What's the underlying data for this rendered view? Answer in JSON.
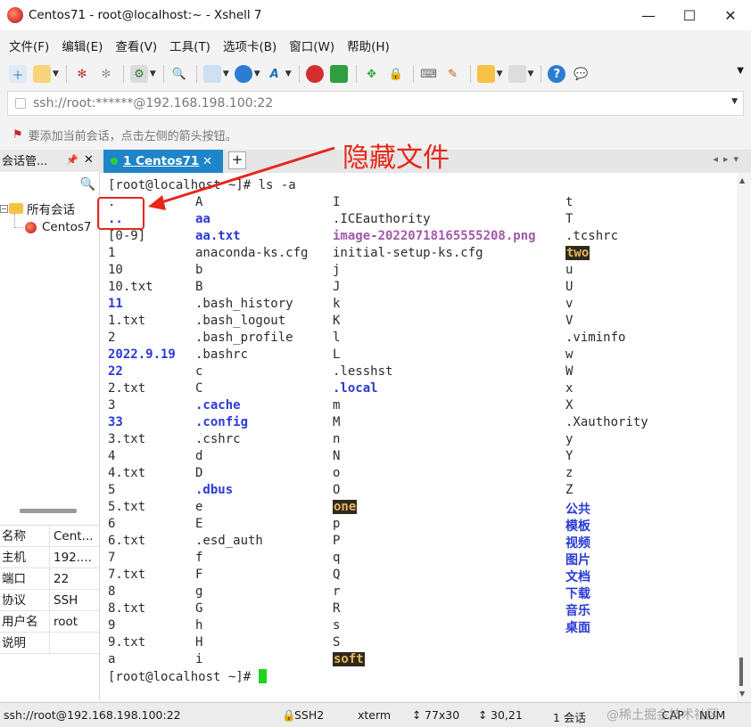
{
  "window": {
    "title": "Centos71 - root@localhost:~ - Xshell 7",
    "minimize": "—",
    "maximize": "☐",
    "close": "✕"
  },
  "menu": [
    "文件(F)",
    "编辑(E)",
    "查看(V)",
    "工具(T)",
    "选项卡(B)",
    "窗口(W)",
    "帮助(H)"
  ],
  "address": {
    "value": "ssh://root:******@192.168.198.100:22"
  },
  "hint": "要添加当前会话，点击左侧的箭头按钮。",
  "sidebar": {
    "header": "会话管...",
    "pin": "📌",
    "close": "✕",
    "tree_root": "所有会话",
    "tree_child": "Centos7",
    "props": [
      {
        "k": "名称",
        "v": "Cent..."
      },
      {
        "k": "主机",
        "v": "192...."
      },
      {
        "k": "端口",
        "v": "22"
      },
      {
        "k": "协议",
        "v": "SSH"
      },
      {
        "k": "用户名",
        "v": "root"
      },
      {
        "k": "说明",
        "v": ""
      }
    ]
  },
  "tab": {
    "label": "1 Centos71",
    "close": "✕",
    "add": "+"
  },
  "terminal": {
    "command_line": "[root@localhost ~]# ls -a",
    "prompt": "[root@localhost ~]# ",
    "col1": [
      {
        "t": ".",
        "c": "plain"
      },
      {
        "t": "..",
        "c": "dir"
      },
      {
        "t": "[0-9]",
        "c": "plain"
      },
      {
        "t": "1",
        "c": "plain"
      },
      {
        "t": "10",
        "c": "plain"
      },
      {
        "t": "10.txt",
        "c": "plain"
      },
      {
        "t": "11",
        "c": "dir"
      },
      {
        "t": "1.txt",
        "c": "plain"
      },
      {
        "t": "2",
        "c": "plain"
      },
      {
        "t": "2022.9.19",
        "c": "dir"
      },
      {
        "t": "22",
        "c": "dir"
      },
      {
        "t": "2.txt",
        "c": "plain"
      },
      {
        "t": "3",
        "c": "plain"
      },
      {
        "t": "33",
        "c": "dir"
      },
      {
        "t": "3.txt",
        "c": "plain"
      },
      {
        "t": "4",
        "c": "plain"
      },
      {
        "t": "4.txt",
        "c": "plain"
      },
      {
        "t": "5",
        "c": "plain"
      },
      {
        "t": "5.txt",
        "c": "plain"
      },
      {
        "t": "6",
        "c": "plain"
      },
      {
        "t": "6.txt",
        "c": "plain"
      },
      {
        "t": "7",
        "c": "plain"
      },
      {
        "t": "7.txt",
        "c": "plain"
      },
      {
        "t": "8",
        "c": "plain"
      },
      {
        "t": "8.txt",
        "c": "plain"
      },
      {
        "t": "9",
        "c": "plain"
      },
      {
        "t": "9.txt",
        "c": "plain"
      },
      {
        "t": "a",
        "c": "plain"
      }
    ],
    "col2": [
      {
        "t": "A",
        "c": "plain"
      },
      {
        "t": "aa",
        "c": "dir"
      },
      {
        "t": "aa.txt",
        "c": "dir"
      },
      {
        "t": "anaconda-ks.cfg",
        "c": "plain"
      },
      {
        "t": "b",
        "c": "plain"
      },
      {
        "t": "B",
        "c": "plain"
      },
      {
        "t": ".bash_history",
        "c": "plain"
      },
      {
        "t": ".bash_logout",
        "c": "plain"
      },
      {
        "t": ".bash_profile",
        "c": "plain"
      },
      {
        "t": ".bashrc",
        "c": "plain"
      },
      {
        "t": "c",
        "c": "plain"
      },
      {
        "t": "C",
        "c": "plain"
      },
      {
        "t": ".cache",
        "c": "dir"
      },
      {
        "t": ".config",
        "c": "dir"
      },
      {
        "t": ".cshrc",
        "c": "plain"
      },
      {
        "t": "d",
        "c": "plain"
      },
      {
        "t": "D",
        "c": "plain"
      },
      {
        "t": ".dbus",
        "c": "dir"
      },
      {
        "t": "e",
        "c": "plain"
      },
      {
        "t": "E",
        "c": "plain"
      },
      {
        "t": ".esd_auth",
        "c": "plain"
      },
      {
        "t": "f",
        "c": "plain"
      },
      {
        "t": "F",
        "c": "plain"
      },
      {
        "t": "g",
        "c": "plain"
      },
      {
        "t": "G",
        "c": "plain"
      },
      {
        "t": "h",
        "c": "plain"
      },
      {
        "t": "H",
        "c": "plain"
      },
      {
        "t": "i",
        "c": "plain"
      }
    ],
    "col3": [
      {
        "t": "I",
        "c": "plain"
      },
      {
        "t": ".ICEauthority",
        "c": "plain"
      },
      {
        "t": "image-20220718165555208.png",
        "c": "img"
      },
      {
        "t": "initial-setup-ks.cfg",
        "c": "plain"
      },
      {
        "t": "j",
        "c": "plain"
      },
      {
        "t": "J",
        "c": "plain"
      },
      {
        "t": "k",
        "c": "plain"
      },
      {
        "t": "K",
        "c": "plain"
      },
      {
        "t": "l",
        "c": "plain"
      },
      {
        "t": "L",
        "c": "plain"
      },
      {
        "t": ".lesshst",
        "c": "plain"
      },
      {
        "t": ".local",
        "c": "dir"
      },
      {
        "t": "m",
        "c": "plain"
      },
      {
        "t": "M",
        "c": "plain"
      },
      {
        "t": "n",
        "c": "plain"
      },
      {
        "t": "N",
        "c": "plain"
      },
      {
        "t": "o",
        "c": "plain"
      },
      {
        "t": "O",
        "c": "plain"
      },
      {
        "t": "one",
        "c": "hl"
      },
      {
        "t": "p",
        "c": "plain"
      },
      {
        "t": "P",
        "c": "plain"
      },
      {
        "t": "q",
        "c": "plain"
      },
      {
        "t": "Q",
        "c": "plain"
      },
      {
        "t": "r",
        "c": "plain"
      },
      {
        "t": "R",
        "c": "plain"
      },
      {
        "t": "s",
        "c": "plain"
      },
      {
        "t": "S",
        "c": "plain"
      },
      {
        "t": "soft",
        "c": "hl"
      }
    ],
    "col4": [
      {
        "t": "t",
        "c": "plain"
      },
      {
        "t": "T",
        "c": "plain"
      },
      {
        "t": ".tcshrc",
        "c": "plain"
      },
      {
        "t": "two",
        "c": "hl"
      },
      {
        "t": "u",
        "c": "plain"
      },
      {
        "t": "U",
        "c": "plain"
      },
      {
        "t": "v",
        "c": "plain"
      },
      {
        "t": "V",
        "c": "plain"
      },
      {
        "t": ".viminfo",
        "c": "plain"
      },
      {
        "t": "w",
        "c": "plain"
      },
      {
        "t": "W",
        "c": "plain"
      },
      {
        "t": "x",
        "c": "plain"
      },
      {
        "t": "X",
        "c": "plain"
      },
      {
        "t": ".Xauthority",
        "c": "plain"
      },
      {
        "t": "y",
        "c": "plain"
      },
      {
        "t": "Y",
        "c": "plain"
      },
      {
        "t": "z",
        "c": "plain"
      },
      {
        "t": "Z",
        "c": "plain"
      },
      {
        "t": "公共",
        "c": "dir"
      },
      {
        "t": "模板",
        "c": "dir"
      },
      {
        "t": "视频",
        "c": "dir"
      },
      {
        "t": "图片",
        "c": "dir"
      },
      {
        "t": "文档",
        "c": "dir"
      },
      {
        "t": "下载",
        "c": "dir"
      },
      {
        "t": "音乐",
        "c": "dir"
      },
      {
        "t": "桌面",
        "c": "dir"
      }
    ]
  },
  "annotation": {
    "text": "隐藏文件",
    "color": "#e8261a"
  },
  "status": {
    "connection": "ssh://root@192.168.198.100:22",
    "protocol": "SSH2",
    "term": "xterm",
    "size": "77x30",
    "pos": "30,21",
    "sessions": "1 会话",
    "caps": "CAP",
    "num": "NUM"
  },
  "watermark": "@稀土掘金技术社区",
  "colors": {
    "tab_active": "#1f84c8",
    "dir": "#2a3bd6",
    "cursor": "#1ed41e",
    "highlight_bg": "#2f2a1c",
    "highlight_fg": "#e6b65a"
  }
}
